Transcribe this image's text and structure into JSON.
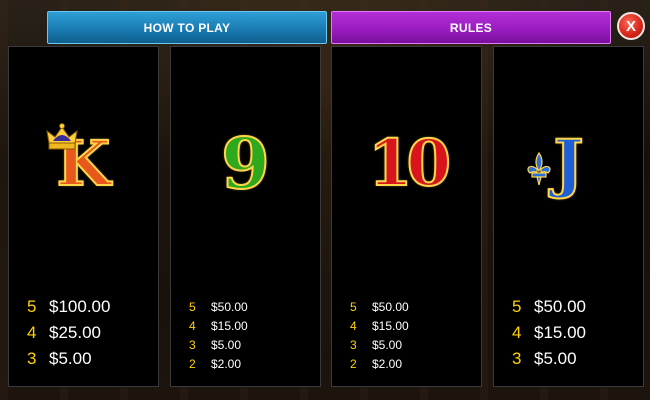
{
  "tabs": {
    "how_to_play": "HOW TO PLAY",
    "rules": "RULES"
  },
  "close_button": {
    "label": "X",
    "icon": "close-icon"
  },
  "colors": {
    "how_to_play_tab": "#1a7cb3",
    "rules_tab": "#9a1dc0",
    "payout_count": "#ffd200",
    "close_button": "#d8281a"
  },
  "symbols": [
    {
      "glyph": "K",
      "icon": "king-crown-icon",
      "pays": [
        {
          "count": "5",
          "amount": "$100.00"
        },
        {
          "count": "4",
          "amount": "$25.00"
        },
        {
          "count": "3",
          "amount": "$5.00"
        }
      ]
    },
    {
      "glyph": "9",
      "pays": [
        {
          "count": "5",
          "amount": "$50.00"
        },
        {
          "count": "4",
          "amount": "$15.00"
        },
        {
          "count": "3",
          "amount": "$5.00"
        },
        {
          "count": "2",
          "amount": "$2.00"
        }
      ]
    },
    {
      "glyph": "10",
      "pays": [
        {
          "count": "5",
          "amount": "$50.00"
        },
        {
          "count": "4",
          "amount": "$15.00"
        },
        {
          "count": "3",
          "amount": "$5.00"
        },
        {
          "count": "2",
          "amount": "$2.00"
        }
      ]
    },
    {
      "glyph": "J",
      "icon": "fleur-de-lis-icon",
      "pays": [
        {
          "count": "5",
          "amount": "$50.00"
        },
        {
          "count": "4",
          "amount": "$15.00"
        },
        {
          "count": "3",
          "amount": "$5.00"
        }
      ]
    }
  ]
}
